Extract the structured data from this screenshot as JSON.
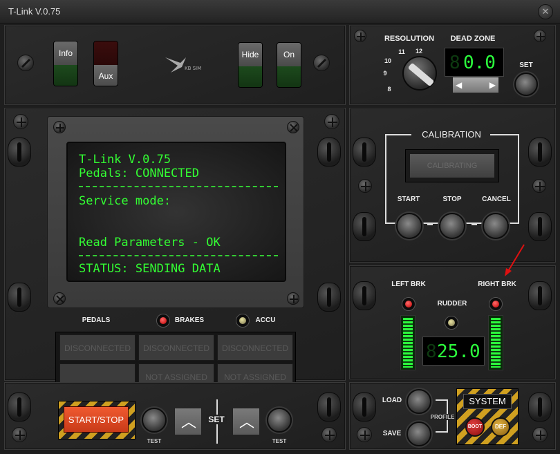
{
  "window": {
    "title": "T-Link V.0.75",
    "close_glyph": "✕"
  },
  "top_buttons": {
    "info": "Info",
    "aux": "Aux",
    "hide": "Hide",
    "on": "On"
  },
  "resolution": {
    "label": "RESOLUTION",
    "ticks": [
      "8",
      "9",
      "10",
      "11",
      "12"
    ]
  },
  "dead_zone": {
    "label": "DEAD ZONE",
    "value": "0.0",
    "set_label": "SET"
  },
  "calibration": {
    "title": "CALIBRATION",
    "display": "CALIBRATING",
    "start": "START",
    "stop": "STOP",
    "cancel": "CANCEL"
  },
  "lcd": {
    "line1": "T-Link V.0.75",
    "line2": "Pedals: CONNECTED",
    "line3": "Service mode:",
    "line4": "Read Parameters - OK",
    "line5": "STATUS: SENDING DATA"
  },
  "indicators": {
    "pedals": "PEDALS",
    "brakes": "BRAKES",
    "accu": "ACCU"
  },
  "status_boxes": [
    "DISCONNECTED",
    "DISCONNECTED",
    "DISCONNECTED",
    "",
    "NOT ASSIGNED",
    "NOT ASSIGNED"
  ],
  "controls": {
    "start_stop": "START/STOP",
    "test_left": "TEST",
    "set": "SET",
    "test_right": "TEST"
  },
  "brakes": {
    "left": "LEFT BRK",
    "right": "RIGHT BRK",
    "rudder": "RUDDER",
    "value": "25.0"
  },
  "profile": {
    "load": "LOAD",
    "save": "SAVE",
    "profile": "PROFILE"
  },
  "system": {
    "title": "SYSTEM",
    "boot": "BOOT",
    "def": "DEF"
  },
  "brand": "KB SIM",
  "colors": {
    "lcd_green": "#33ff33",
    "led_red": "#e00000",
    "hazard_yellow": "#d0a020",
    "start_stop": "#e04020"
  }
}
